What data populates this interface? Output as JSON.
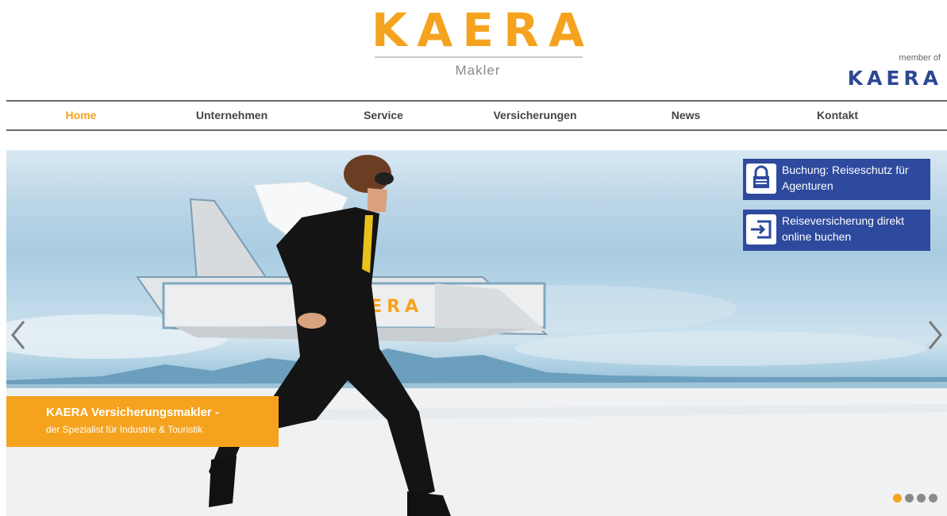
{
  "header": {
    "logo_text": "KAERA",
    "logo_subtitle": "Makler",
    "member_of_label": "member of",
    "member_logo_text": "KAERA"
  },
  "nav": {
    "items": [
      {
        "label": "Home",
        "active": true
      },
      {
        "label": "Unternehmen",
        "active": false
      },
      {
        "label": "Service",
        "active": false
      },
      {
        "label": "Versicherungen",
        "active": false
      },
      {
        "label": "News",
        "active": false
      },
      {
        "label": "Kontakt",
        "active": false
      }
    ]
  },
  "slider": {
    "caption_title": "KAERA Versicherungsmakler -",
    "caption_subtitle": "der Spezialist für Industrie & Touristik",
    "plane_text": "KAERA",
    "cta": [
      {
        "icon": "lock-icon",
        "label": "Buchung: Reiseschutz für Agenturen"
      },
      {
        "icon": "login-icon",
        "label": "Reiseversicherung direkt online buchen"
      }
    ],
    "dots_count": 4,
    "active_dot": 1
  },
  "colors": {
    "accent": "#f5a31f",
    "brand_blue": "#2e4a9e",
    "nav_border": "#6b6b6b"
  }
}
